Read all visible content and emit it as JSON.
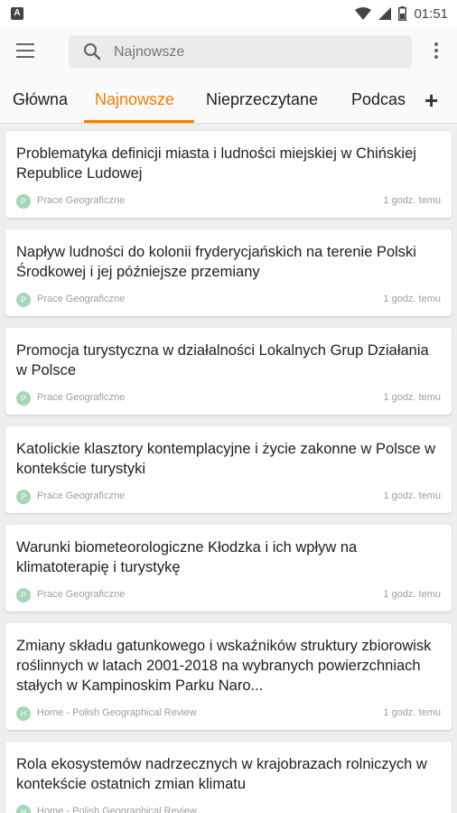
{
  "status": {
    "time": "01:51",
    "left_icon": "A"
  },
  "search": {
    "placeholder": "Najnowsze"
  },
  "tabs": [
    {
      "label": "Główna"
    },
    {
      "label": "Najnowsze"
    },
    {
      "label": "Nieprzeczytane"
    },
    {
      "label": "Podcas"
    }
  ],
  "active_tab": "Najnowsze",
  "colors": {
    "accent": "#f57c00",
    "source_icon": "#a5d6b7"
  },
  "articles": [
    {
      "title": "Problematyka definicji miasta i ludności miejskiej w Chińskiej Republice Ludowej",
      "source": "Prace Geograficzne",
      "time": "1 godz. temu",
      "icon_letter": "P"
    },
    {
      "title": "Napływ ludności do kolonii fryderycjańskich na terenie Polski Środkowej i jej późniejsze przemiany",
      "source": "Prace Geograficzne",
      "time": "1 godz. temu",
      "icon_letter": "P"
    },
    {
      "title": "Promocja turystyczna w działalności Lokalnych Grup Działania w Polsce",
      "source": "Prace Geograficzne",
      "time": "1 godz. temu",
      "icon_letter": "P"
    },
    {
      "title": "Katolickie klasztory kontemplacyjne i życie zakonne w Polsce w kontekście turystyki",
      "source": "Prace Geograficzne",
      "time": "1 godz. temu",
      "icon_letter": "P"
    },
    {
      "title": "Warunki biometeorologiczne Kłodzka i ich wpływ na klimatoterapię i turystykę",
      "source": "Prace Geograficzne",
      "time": "1 godz. temu",
      "icon_letter": "P"
    },
    {
      "title": "Zmiany składu gatunkowego i wskaźników struktury zbiorowisk roślinnych w latach 2001-2018 na wybranych powierzchniach stałych w Kampinoskim Parku Naro...",
      "source": "Home - Polish Geographical Review",
      "time": "1 godz. temu",
      "icon_letter": "H"
    },
    {
      "title": "Rola ekosystemów nadrzecznych w krajobrazach rolniczych w kontekście ostatnich zmian klimatu",
      "source": "Home - Polish Geographical Review",
      "time": "",
      "icon_letter": "H"
    }
  ]
}
